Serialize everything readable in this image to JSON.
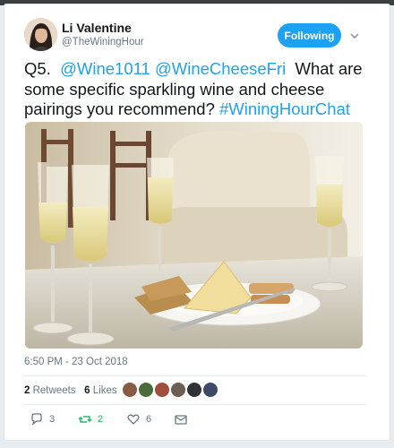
{
  "author": {
    "name": "Li Valentine",
    "handle": "@TheWiningHour"
  },
  "follow_label": "Following",
  "tweet": {
    "prefix": "Q5.",
    "mention1": "@Wine1011",
    "mention2": "@WineCheeseFri",
    "body": "What are some specific sparkling wine and cheese pairings you recommend?",
    "hashtag": "#WiningHourChat"
  },
  "timestamp": "6:50 PM - 23 Oct 2018",
  "stats": {
    "retweets_count": "2",
    "retweets_label": "Retweets",
    "likes_count": "6",
    "likes_label": "Likes"
  },
  "actions": {
    "reply_count": "3",
    "retweet_count": "2",
    "like_count": "6"
  },
  "colors": {
    "accent": "#1da1f2",
    "retweet": "#17bf63",
    "muted": "#657786"
  },
  "icons": [
    "chevron-down-icon",
    "reply-icon",
    "retweet-icon",
    "heart-icon",
    "message-icon"
  ]
}
